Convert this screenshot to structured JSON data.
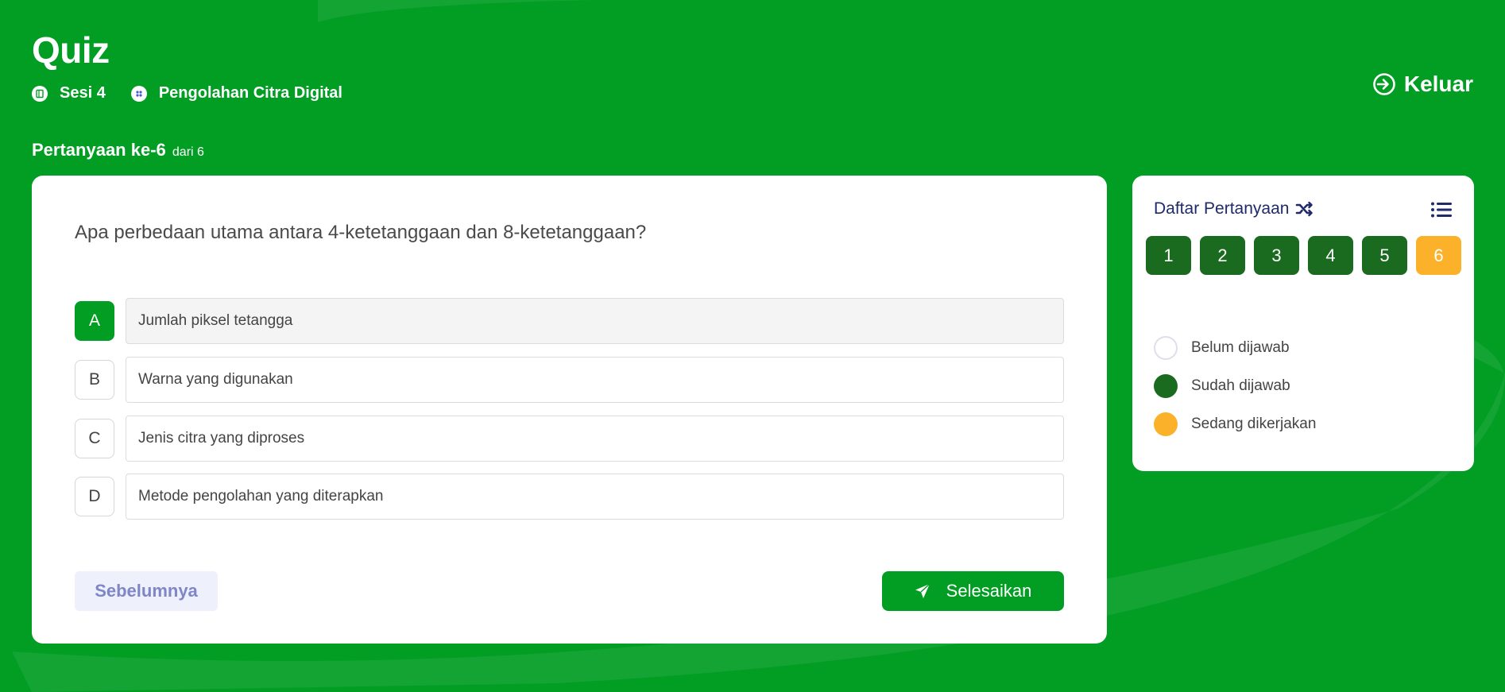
{
  "header": {
    "title": "Quiz",
    "session": "Sesi 4",
    "course": "Pengolahan Citra Digital",
    "exit_label": "Keluar"
  },
  "progress": {
    "prefix": "Pertanyaan ke-6",
    "suffix": "dari 6"
  },
  "question": {
    "text": "Apa perbedaan utama antara 4-ketetanggaan dan 8-ketetanggaan?",
    "options": [
      {
        "letter": "A",
        "text": "Jumlah piksel tetangga",
        "selected": true
      },
      {
        "letter": "B",
        "text": "Warna yang digunakan",
        "selected": false
      },
      {
        "letter": "C",
        "text": "Jenis citra yang diproses",
        "selected": false
      },
      {
        "letter": "D",
        "text": "Metode pengolahan yang diterapkan",
        "selected": false
      }
    ]
  },
  "nav": {
    "prev_label": "Sebelumnya",
    "finish_label": "Selesaikan"
  },
  "panel": {
    "title": "Daftar Pertanyaan",
    "numbers": [
      "1",
      "2",
      "3",
      "4",
      "5",
      "6"
    ],
    "current": "6",
    "legend": {
      "unanswered": "Belum dijawab",
      "answered": "Sudah dijawab",
      "in_progress": "Sedang dikerjakan"
    }
  },
  "icons": {
    "session": "book-icon",
    "course": "category-icon",
    "exit": "login-arrow-icon",
    "shuffle": "shuffle-icon",
    "list": "list-icon",
    "send": "paper-plane-icon"
  },
  "colors": {
    "background": "#029e24",
    "answered": "#1a6a20",
    "current": "#fbb22a",
    "prev_text": "#7f86c8",
    "panel_title": "#1f2a6a"
  }
}
